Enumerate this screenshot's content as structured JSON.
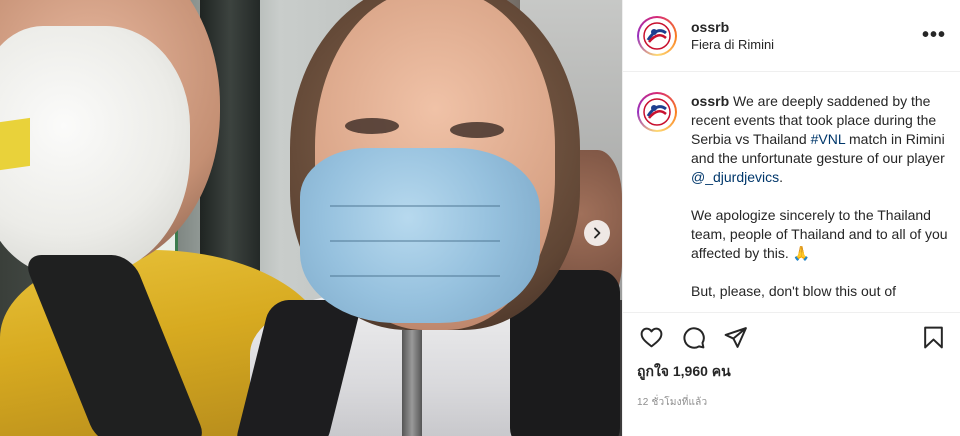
{
  "post": {
    "username": "ossrb",
    "location": "Fiera di Rimini",
    "caption": {
      "username": "ossrb",
      "part1": "We are deeply saddened by the recent events that took place during the Serbia vs Thailand",
      "hashtag": "#VNL",
      "part2": "match in Rimini and the unfortunate gesture of our player",
      "mention": "@_djurdjevics",
      "part3": ".",
      "paragraph2": "We apologize sincerely to the Thailand team, people of Thailand and to all of you affected by this.",
      "emoji": "🙏",
      "paragraph3": "But, please, don't blow this out of"
    },
    "likes": "ถูกใจ 1,960 คน",
    "time_ago": "12 ชั่วโมงที่แล้ว"
  },
  "icons": {
    "more": "more-options-icon",
    "like": "heart-icon",
    "comment": "comment-icon",
    "share": "share-icon",
    "save": "bookmark-icon",
    "next": "chevron-right-icon"
  },
  "colors": {
    "link": "#00376b",
    "text": "#262626",
    "muted": "#8e8e8e"
  }
}
